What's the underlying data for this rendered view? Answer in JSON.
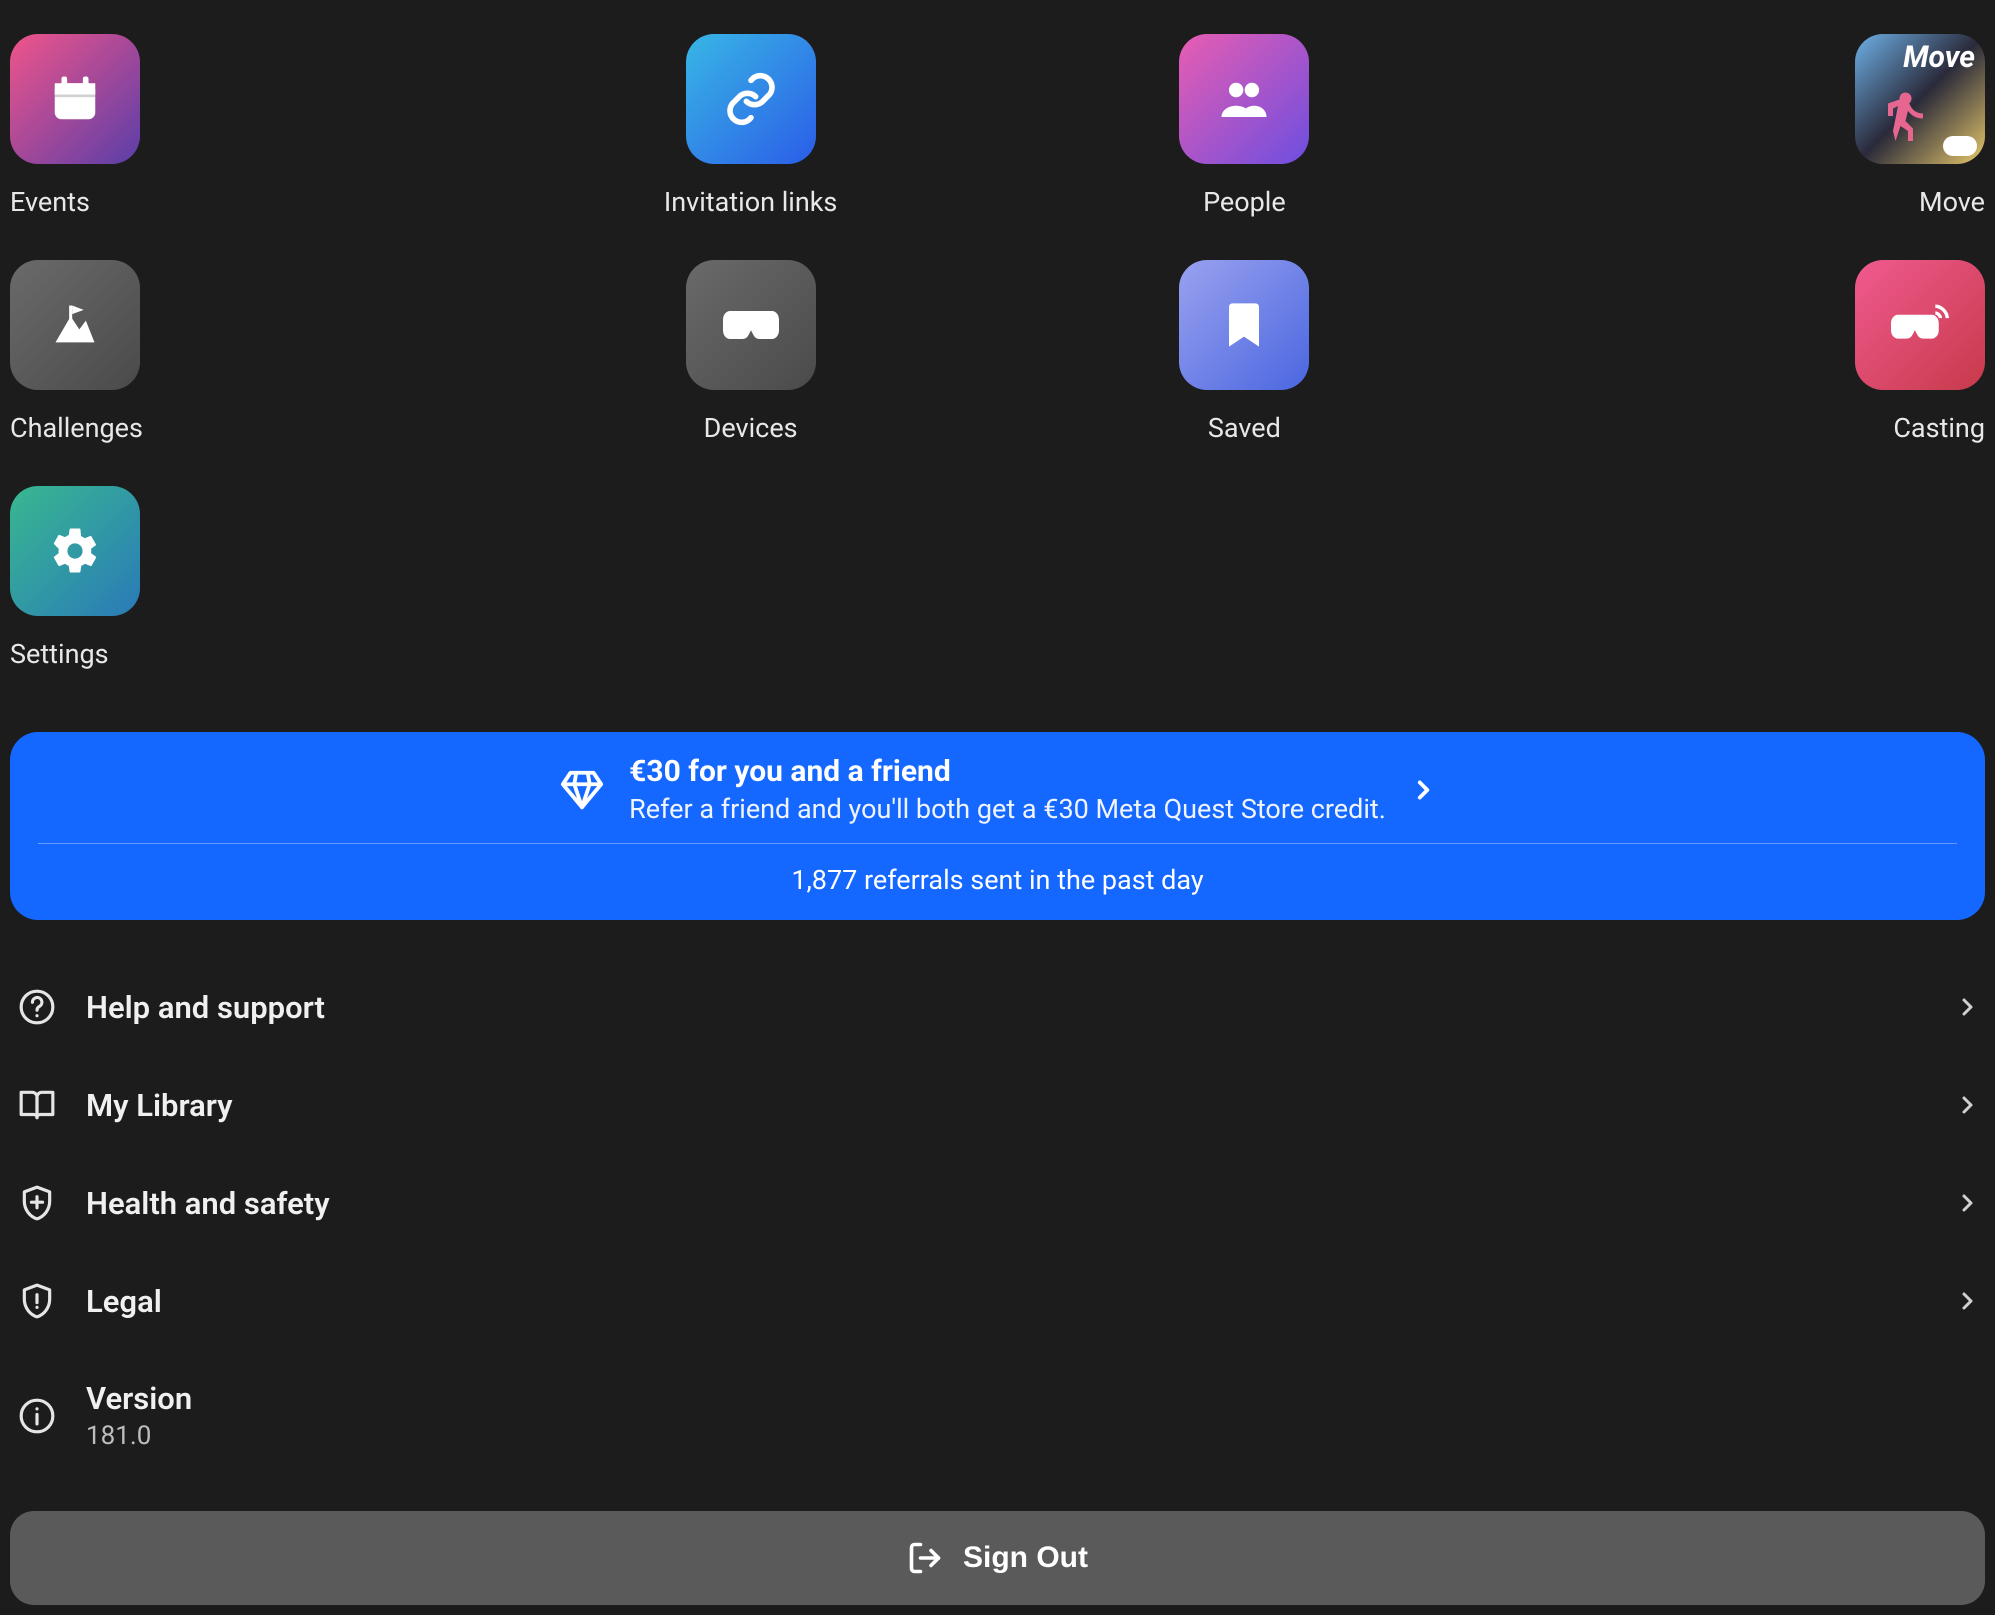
{
  "apps": [
    {
      "label": "Events"
    },
    {
      "label": "Invitation links"
    },
    {
      "label": "People"
    },
    {
      "label": "Move"
    },
    {
      "label": "Challenges"
    },
    {
      "label": "Devices"
    },
    {
      "label": "Saved"
    },
    {
      "label": "Casting"
    },
    {
      "label": "Settings"
    }
  ],
  "referral": {
    "title": "€30 for you and a friend",
    "subtitle": "Refer a friend and you'll both get a €30 Meta Quest Store credit.",
    "footer": "1,877 referrals sent in the past day"
  },
  "menu": {
    "help": {
      "label": "Help and support"
    },
    "library": {
      "label": "My Library"
    },
    "health": {
      "label": "Health and safety"
    },
    "legal": {
      "label": "Legal"
    },
    "version": {
      "label": "Version",
      "value": "181.0"
    }
  },
  "signout_label": "Sign Out"
}
